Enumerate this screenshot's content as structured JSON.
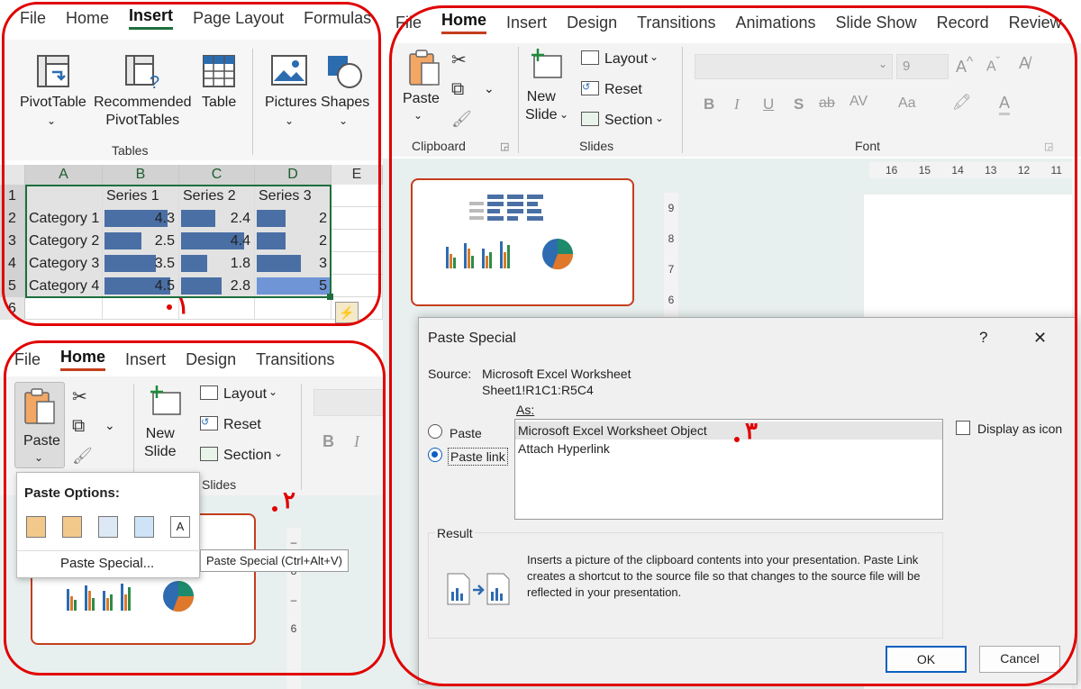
{
  "excel": {
    "tabs": [
      "File",
      "Home",
      "Insert",
      "Page Layout",
      "Formulas"
    ],
    "active_tab": "Insert",
    "buttons": {
      "pivottable": "PivotTable",
      "recommended": "Recommended\nPivotTables",
      "table": "Table",
      "pictures": "Pictures",
      "shapes": "Shapes"
    },
    "group_label": "Tables",
    "columns": [
      "A",
      "B",
      "C",
      "D",
      "E"
    ],
    "rows": [
      {
        "num": "1",
        "label": "",
        "values": [
          "Series 1",
          "Series 2",
          "Series 3"
        ]
      },
      {
        "num": "2",
        "label": "Category 1",
        "values": [
          "4.3",
          "2.4",
          "2"
        ]
      },
      {
        "num": "3",
        "label": "Category 2",
        "values": [
          "2.5",
          "4.4",
          "2"
        ]
      },
      {
        "num": "4",
        "label": "Category 3",
        "values": [
          "3.5",
          "1.8",
          "3"
        ]
      },
      {
        "num": "5",
        "label": "Category 4",
        "values": [
          "4.5",
          "2.8",
          "5"
        ]
      },
      {
        "num": "6",
        "label": "",
        "values": [
          "",
          "",
          ""
        ]
      }
    ],
    "bar_fractions": [
      [
        0.86,
        0.48,
        0.4
      ],
      [
        0.5,
        0.88,
        0.4
      ],
      [
        0.7,
        0.36,
        0.6
      ],
      [
        0.9,
        0.56,
        1.0
      ]
    ],
    "step_number": "۱"
  },
  "ppt_small": {
    "tabs": [
      "File",
      "Home",
      "Insert",
      "Design",
      "Transitions"
    ],
    "active_tab": "Home",
    "paste_label": "Paste",
    "new_slide_label": "New\nSlide",
    "layout_label": "Layout",
    "reset_label": "Reset",
    "section_label": "Section",
    "slides_group": "Slides",
    "paste_options_title": "Paste Options:",
    "paste_special_item": "Paste Special...",
    "tooltip": "Paste Special (Ctrl+Alt+V)",
    "step_number": "۲"
  },
  "ppt_large": {
    "tabs": [
      "File",
      "Home",
      "Insert",
      "Design",
      "Transitions",
      "Animations",
      "Slide Show",
      "Record",
      "Review"
    ],
    "active_tab": "Home",
    "paste_label": "Paste",
    "new_slide_label": "New\nSlide",
    "layout_label": "Layout",
    "reset_label": "Reset",
    "section_label": "Section",
    "clipboard_group": "Clipboard",
    "slides_group": "Slides",
    "font_group": "Font",
    "font_size": "9",
    "ruler_h": [
      "16",
      "15",
      "14",
      "13",
      "12",
      "11"
    ],
    "ruler_v": [
      "9",
      "8",
      "7",
      "6"
    ]
  },
  "dialog": {
    "title": "Paste Special",
    "help": "?",
    "close": "✕",
    "source_label": "Source:",
    "source_value": "Microsoft Excel Worksheet",
    "source_range": "Sheet1!R1C1:R5C4",
    "as_label": "As:",
    "radio_paste": "Paste",
    "radio_paste_link": "Paste link",
    "list": [
      "Microsoft Excel Worksheet Object",
      "Attach Hyperlink"
    ],
    "display_as_icon": "Display as icon",
    "result_label": "Result",
    "result_text": "Inserts a picture of the clipboard contents into your presentation. Paste Link creates a shortcut to the source file so that changes to the source file will be reflected in your presentation.",
    "ok": "OK",
    "cancel": "Cancel",
    "step_number": "۳"
  },
  "colors": {
    "excel_accent": "#1e6f3d",
    "ppt_accent": "#c43e1c",
    "annotation": "#e00000",
    "databar": "#4a6fa5"
  }
}
